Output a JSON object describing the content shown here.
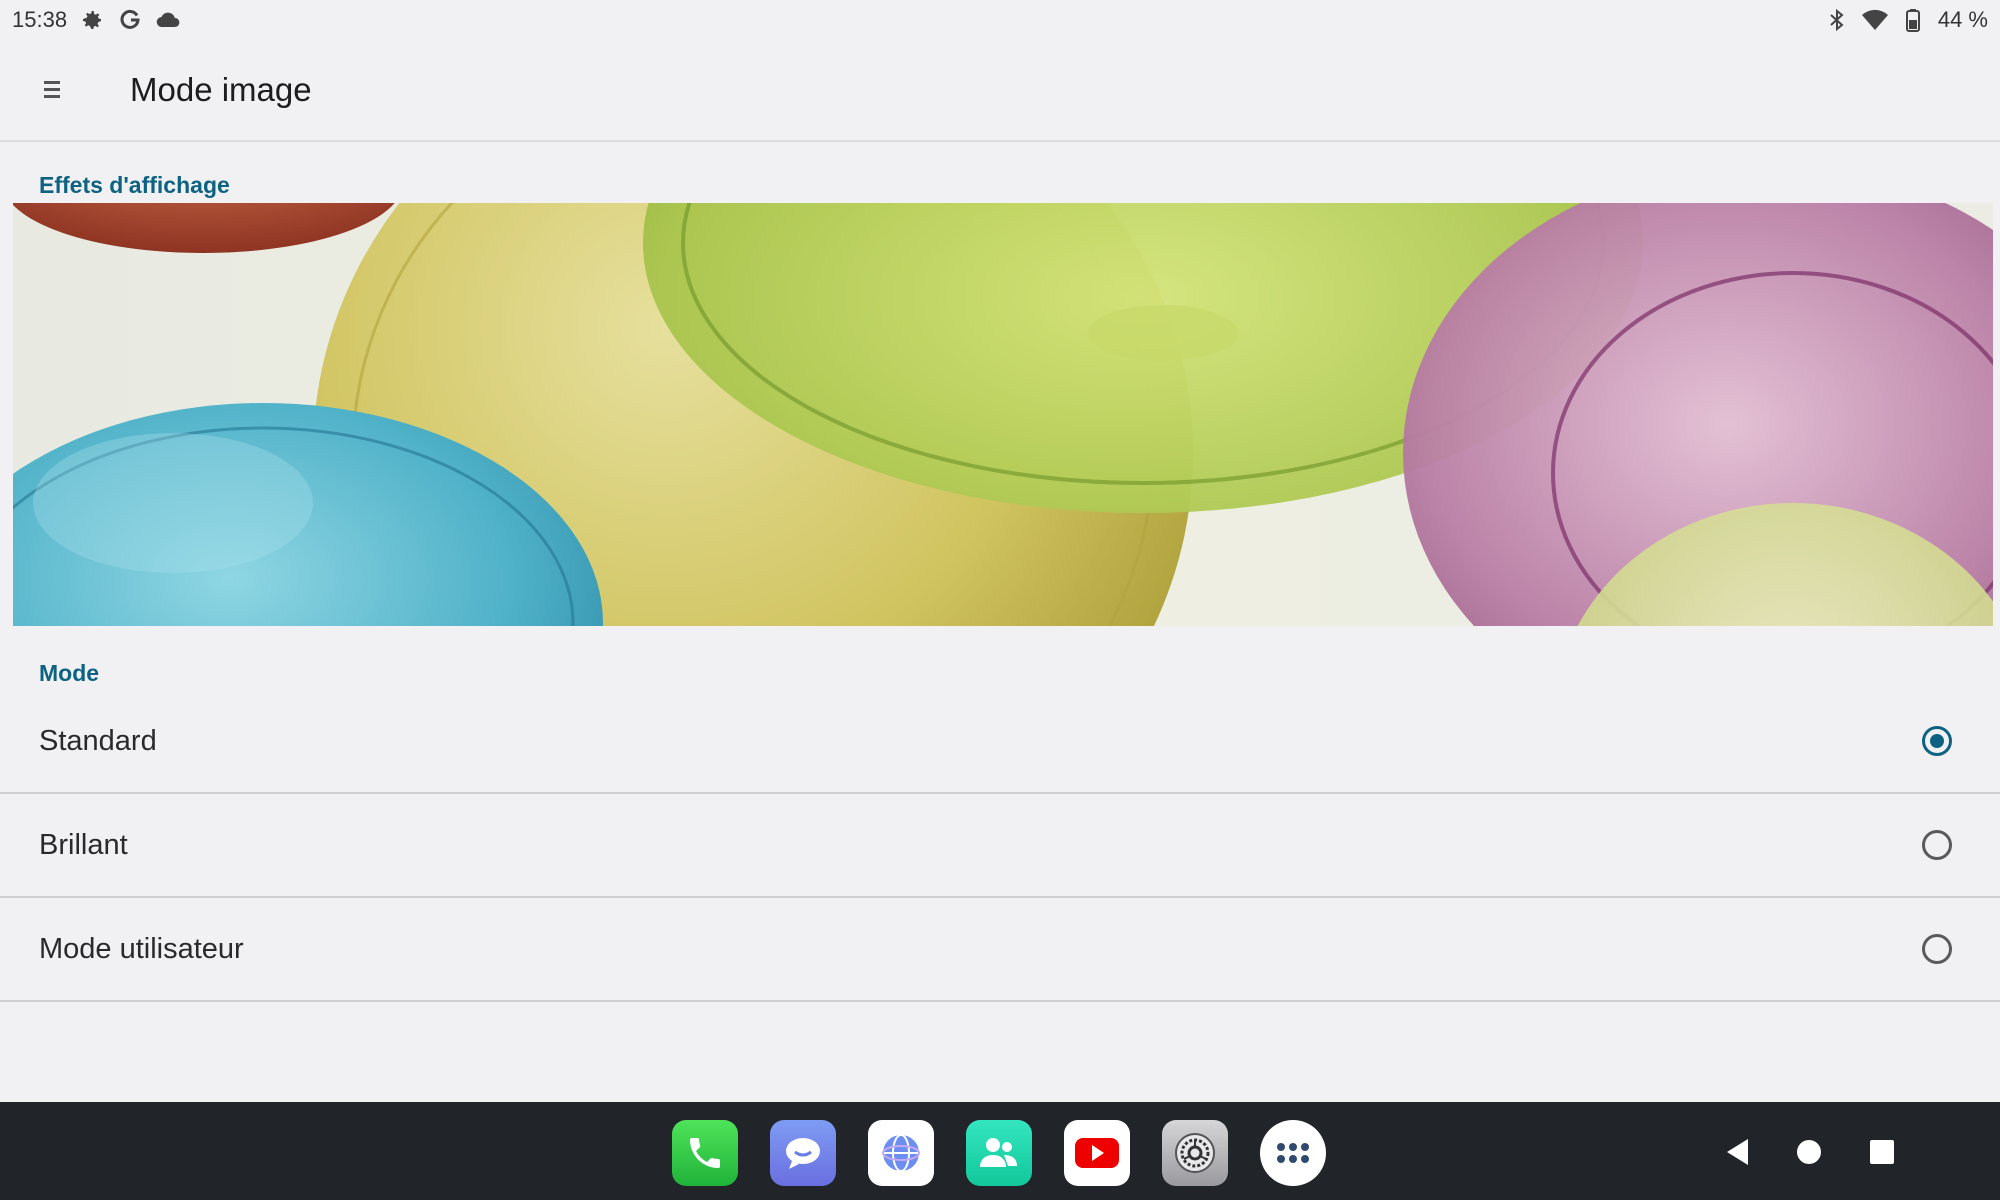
{
  "status_bar": {
    "time": "15:38",
    "left_icons": [
      "gear-icon",
      "google-icon",
      "cloud-icon"
    ],
    "right_icons": [
      "bluetooth-icon",
      "wifi-icon",
      "battery-icon"
    ],
    "battery": "44 %"
  },
  "app_bar": {
    "menu_icon": "hamburger-menu-icon",
    "title": "Mode image"
  },
  "effects_section": {
    "label": "Effets d'affichage"
  },
  "mode_section": {
    "label": "Mode",
    "options": [
      {
        "label": "Standard",
        "selected": true
      },
      {
        "label": "Brillant",
        "selected": false
      },
      {
        "label": "Mode utilisateur",
        "selected": false
      }
    ]
  },
  "dock": {
    "apps": [
      "phone-icon",
      "messages-icon",
      "browser-icon",
      "contacts-icon",
      "youtube-icon",
      "settings-icon",
      "app-drawer-icon"
    ]
  },
  "nav_buttons": [
    "back-icon",
    "home-icon",
    "recents-icon"
  ],
  "colors": {
    "accent": "#0d6282",
    "background": "#f1f1f3",
    "navbar": "#212529"
  }
}
